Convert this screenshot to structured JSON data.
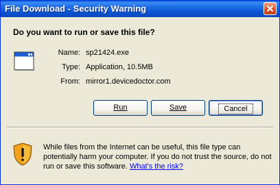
{
  "window": {
    "title": "File Download - Security Warning"
  },
  "dialog": {
    "question": "Do you want to run or save this file?",
    "file": {
      "name_label": "Name:",
      "name_value": "sp21424.exe",
      "type_label": "Type:",
      "type_value": "Application, 10.5MB",
      "from_label": "From:",
      "from_value": "mirror1.devicedoctor.com"
    },
    "buttons": {
      "run": "Run",
      "save": "Save",
      "cancel": "Cancel"
    },
    "warning": {
      "text": "While files from the Internet can be useful, this file type can potentially harm your computer. If you do not trust the source, do not run or save this software.",
      "link": "What's the risk?"
    }
  },
  "icons": {
    "close": "close-icon",
    "file": "application-window-icon",
    "shield": "security-shield-icon"
  },
  "colors": {
    "titlebar": "#0b55d3",
    "dialog_bg": "#ece9d8",
    "link": "#0000ff",
    "button_border": "#003c74",
    "close_button": "#d9532b",
    "shield_orange": "#f3a21b"
  }
}
